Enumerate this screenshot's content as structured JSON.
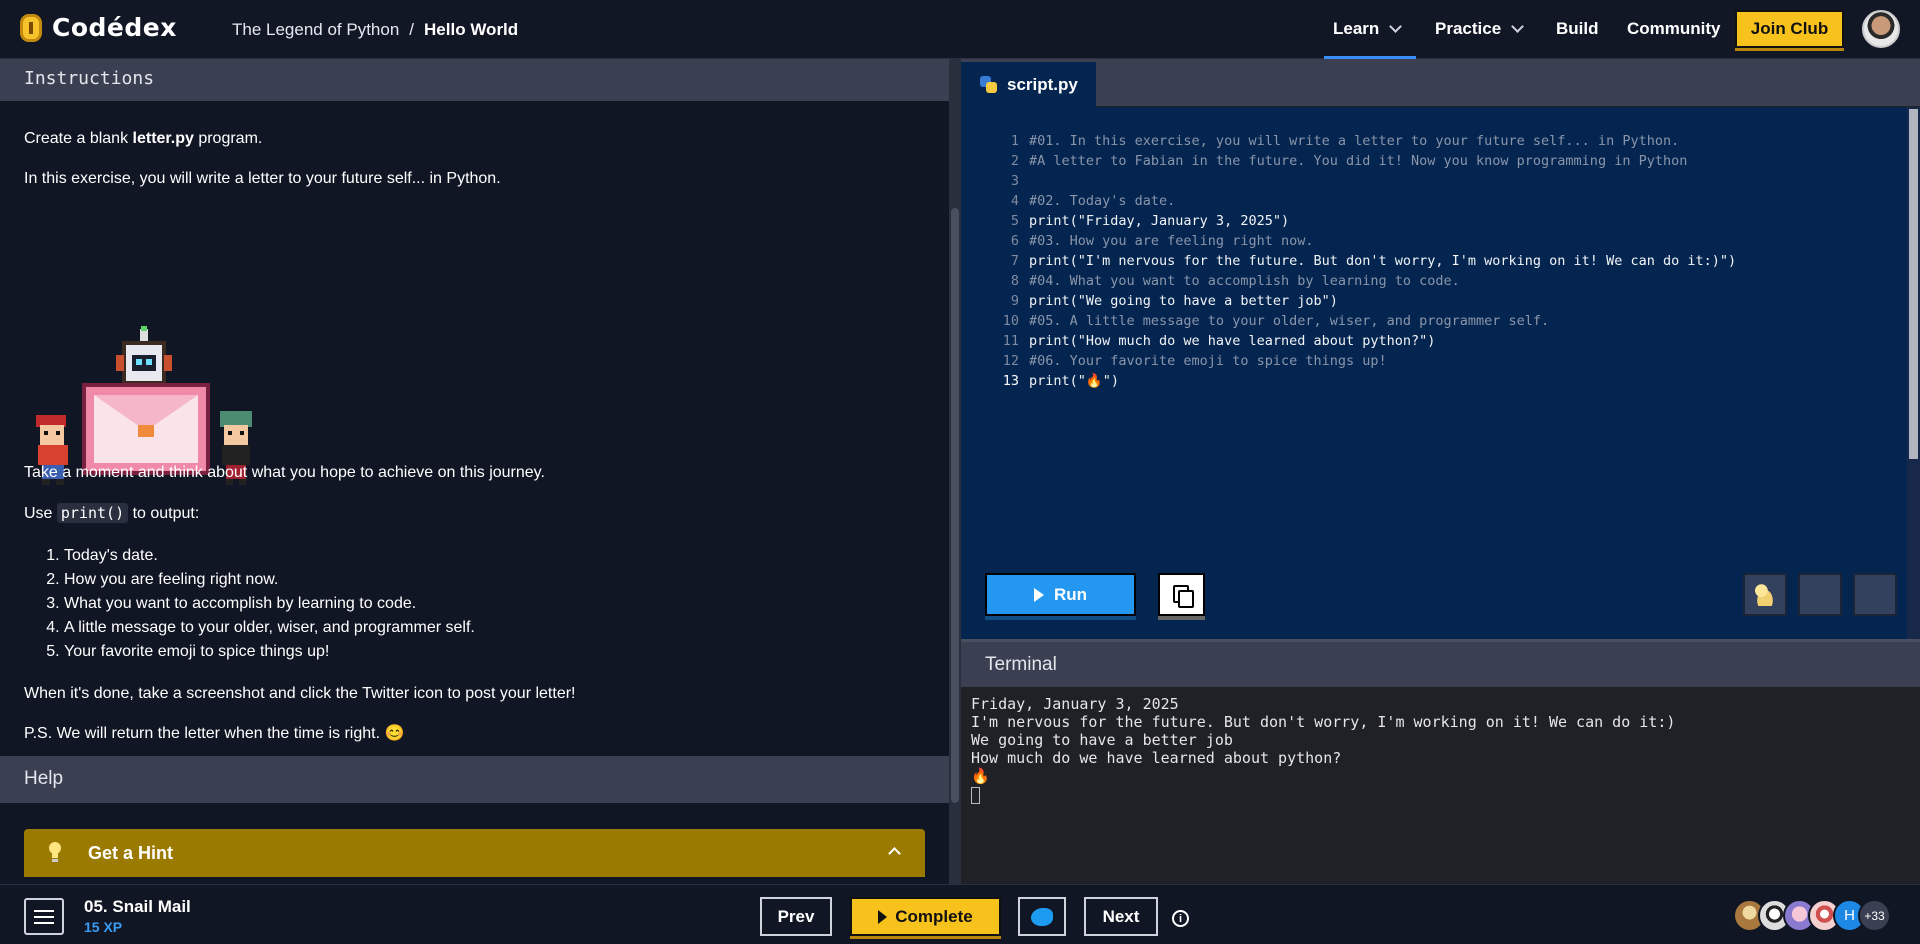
{
  "app": {
    "logo_text": "Codédex",
    "breadcrumb_course": "The Legend of Python",
    "breadcrumb_sep": "/",
    "breadcrumb_lesson": "Hello World"
  },
  "nav": {
    "learn": "Learn",
    "practice": "Practice",
    "build": "Build",
    "community": "Community",
    "join_club": "Join Club",
    "active": "Learn",
    "accent": "#3a8ef7"
  },
  "instructions": {
    "title": "Instructions",
    "p1_pre": "Create a blank ",
    "p1_file": "letter.py",
    "p1_post": " program.",
    "p2": "In this exercise, you will write a letter to your future self... in Python.",
    "p3": "Take a moment and think about what you hope to achieve on this journey.",
    "p4_pre": "Use ",
    "p4_code": "print()",
    "p4_post": " to output:",
    "list": [
      "Today's date.",
      "How you are feeling right now.",
      "What you want to accomplish by learning to code.",
      "A little message to your older, wiser, and programmer self.",
      "Your favorite emoji to spice things up!"
    ],
    "p5": "When it's done, take a screenshot and click the Twitter icon to post your letter!",
    "p6": "P.S. We will return the letter when the time is right. 😊"
  },
  "help": {
    "title": "Help",
    "hint_label": "Get a Hint"
  },
  "editor": {
    "tab_label": "script.py",
    "lines": [
      {
        "n": "1",
        "kind": "comment",
        "text": "#01. In this exercise, you will write a letter to your future self... in Python."
      },
      {
        "n": "2",
        "kind": "comment",
        "text": "#A letter to Fabian in the future. You did it! Now you know programming in Python"
      },
      {
        "n": "3",
        "kind": "comment",
        "text": ""
      },
      {
        "n": "4",
        "kind": "comment",
        "text": "#02. Today's date."
      },
      {
        "n": "5",
        "kind": "stmt",
        "text": "print(\"Friday, January 3, 2025\")"
      },
      {
        "n": "6",
        "kind": "comment",
        "text": "#03. How you are feeling right now."
      },
      {
        "n": "7",
        "kind": "stmt",
        "text": "print(\"I'm nervous for the future. But don't worry, I'm working on it! We can do it:)\")"
      },
      {
        "n": "8",
        "kind": "comment",
        "text": "#04. What you want to accomplish by learning to code."
      },
      {
        "n": "9",
        "kind": "stmt",
        "text": "print(\"We going to have a better job\")"
      },
      {
        "n": "10",
        "kind": "comment",
        "text": "#05. A little message to your older, wiser, and programmer self."
      },
      {
        "n": "11",
        "kind": "stmt",
        "text": "print(\"How much do we have learned about python?\")"
      },
      {
        "n": "12",
        "kind": "comment",
        "text": "#06. Your favorite emoji to spice things up!"
      },
      {
        "n": "13",
        "kind": "stmt",
        "text": "print(\"🔥\")"
      }
    ],
    "active_line": "13",
    "run_label": "Run",
    "bg_color": "#04254f"
  },
  "terminal": {
    "title": "Terminal",
    "output": [
      "Friday, January 3, 2025",
      "I'm nervous for the future. But don't worry, I'm working on it! We can do it:)",
      "We going to have a better job",
      "How much do we have learned about python?",
      "🔥"
    ]
  },
  "bottom": {
    "lesson_name": "05. Snail Mail",
    "lesson_xp": "15 XP",
    "prev": "Prev",
    "complete": "Complete",
    "next": "Next",
    "info": "i",
    "avatar_letter": "H",
    "more_count": "+33"
  }
}
